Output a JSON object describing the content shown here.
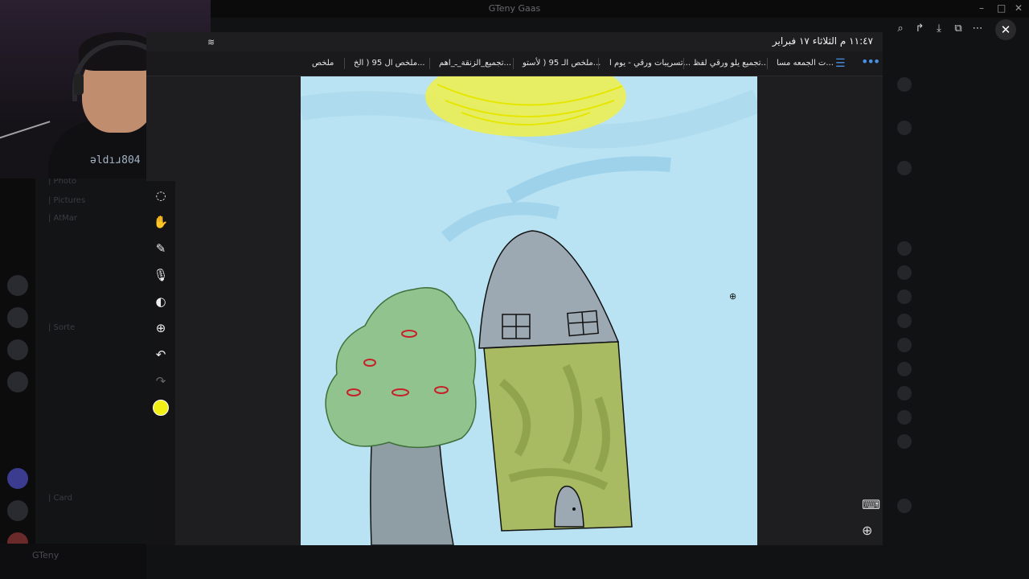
{
  "window_title": "GTeny Gaas",
  "webcam": {
    "hoodie_text": "ǝldıɹ804"
  },
  "viewer": {
    "datetime": "١١:٤٧ م  الثلاثاء ١٧ فبراير",
    "tabs": [
      "ملخص",
      "ملخص ال 95 ( الخ...",
      "تجميع_الزنقة_ـ_اهم...",
      "ملخص الـ 95 ( لأستو...",
      "تسريبات ورقي - يوم ا...",
      "تجميع  يلو ورقي لفظ...",
      "ت الجمعه مسا..."
    ],
    "tools": [
      "lasso-icon",
      "hand-icon",
      "pen-icon",
      "microphone-icon",
      "sticker-icon",
      "add-icon",
      "undo-icon",
      "redo-icon"
    ],
    "pen_color": "#f2ef15"
  },
  "colors": {
    "accent": "#4a90e2",
    "canvas_sky": "#b9e3f3"
  },
  "server_bg": {
    "channels": [
      "| Photo",
      "| Pictures",
      "| AtMar",
      "| Sorte",
      "| Card"
    ]
  },
  "user": {
    "name": "GTeny"
  }
}
